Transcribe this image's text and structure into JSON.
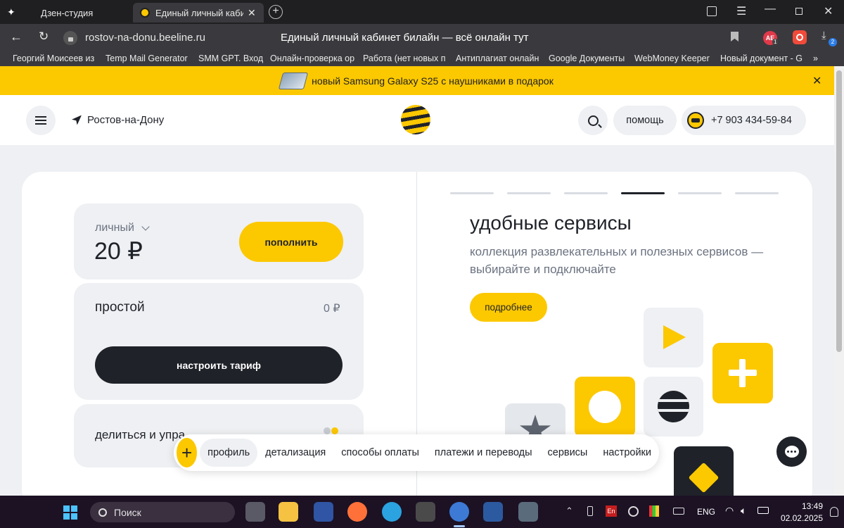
{
  "browser": {
    "tabs": [
      {
        "label": "Дзен-студия"
      },
      {
        "label": "Единый личный кабинет билайн"
      }
    ],
    "url": "rostov-na-donu.beeline.ru",
    "page_title": "Единый личный кабинет билайн — всё онлайн тут",
    "extension_badge_1": "1",
    "download_badge": "2",
    "ext_label": "AE",
    "bookmarks": [
      "Георгий Моисеев из",
      "Temp Mail Generator",
      "SMM GPT. Вход",
      "Онлайн-проверка ор",
      "Работа (нет новых п",
      "Антиплагиат онлайн",
      "Google Документы",
      "WebMoney Keeper",
      "Новый документ - G",
      "»"
    ]
  },
  "promo": {
    "text": "новый Samsung Galaxy S25 с наушниками в подарок"
  },
  "header": {
    "city": "Ростов-на-Дону",
    "help_label": "помощь",
    "phone": "+7 903 434-59-84"
  },
  "account": {
    "account_type": "личный",
    "balance": "20 ₽",
    "topup_label": "пополнить",
    "tariff_name": "простой",
    "tariff_price": "0 ₽",
    "configure_label": "настроить тариф",
    "share_label": "делиться и упра"
  },
  "carousel": {
    "slides_count": 6,
    "active_index": 3,
    "title": "удобные сервисы",
    "description": "коллекция развлекательных и полезных сервисов — выбирайте и подключайте",
    "more_label": "подробнее"
  },
  "bottom_nav": {
    "add_label": "+",
    "items": [
      "профиль",
      "детализация",
      "способы оплаты",
      "платежи и переводы",
      "сервисы",
      "настройки"
    ],
    "active_index": 0
  },
  "taskbar": {
    "search_placeholder": "Поиск",
    "lang": "ENG",
    "time": "13:49",
    "date": "02.02.2025"
  },
  "colors": {
    "brand_yellow": "#fcc800",
    "dark": "#1f2229",
    "light_gray": "#eef0f3"
  }
}
